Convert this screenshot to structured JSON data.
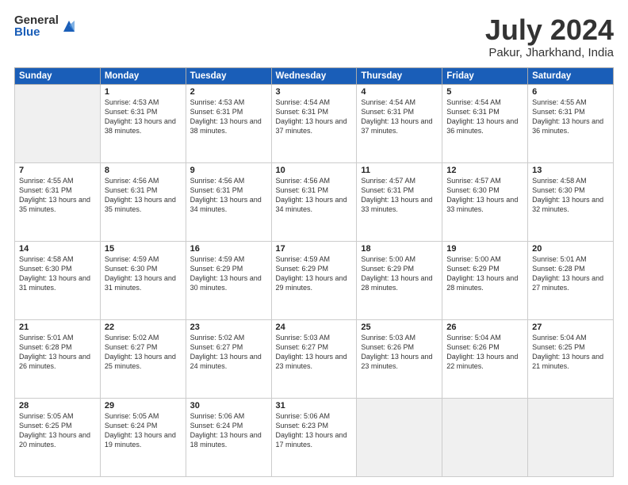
{
  "header": {
    "logo_general": "General",
    "logo_blue": "Blue",
    "main_title": "July 2024",
    "subtitle": "Pakur, Jharkhand, India"
  },
  "calendar": {
    "headers": [
      "Sunday",
      "Monday",
      "Tuesday",
      "Wednesday",
      "Thursday",
      "Friday",
      "Saturday"
    ],
    "weeks": [
      [
        {
          "day": "",
          "info": ""
        },
        {
          "day": "1",
          "info": "Sunrise: 4:53 AM\nSunset: 6:31 PM\nDaylight: 13 hours\nand 38 minutes."
        },
        {
          "day": "2",
          "info": "Sunrise: 4:53 AM\nSunset: 6:31 PM\nDaylight: 13 hours\nand 38 minutes."
        },
        {
          "day": "3",
          "info": "Sunrise: 4:54 AM\nSunset: 6:31 PM\nDaylight: 13 hours\nand 37 minutes."
        },
        {
          "day": "4",
          "info": "Sunrise: 4:54 AM\nSunset: 6:31 PM\nDaylight: 13 hours\nand 37 minutes."
        },
        {
          "day": "5",
          "info": "Sunrise: 4:54 AM\nSunset: 6:31 PM\nDaylight: 13 hours\nand 36 minutes."
        },
        {
          "day": "6",
          "info": "Sunrise: 4:55 AM\nSunset: 6:31 PM\nDaylight: 13 hours\nand 36 minutes."
        }
      ],
      [
        {
          "day": "7",
          "info": "Sunrise: 4:55 AM\nSunset: 6:31 PM\nDaylight: 13 hours\nand 35 minutes."
        },
        {
          "day": "8",
          "info": "Sunrise: 4:56 AM\nSunset: 6:31 PM\nDaylight: 13 hours\nand 35 minutes."
        },
        {
          "day": "9",
          "info": "Sunrise: 4:56 AM\nSunset: 6:31 PM\nDaylight: 13 hours\nand 34 minutes."
        },
        {
          "day": "10",
          "info": "Sunrise: 4:56 AM\nSunset: 6:31 PM\nDaylight: 13 hours\nand 34 minutes."
        },
        {
          "day": "11",
          "info": "Sunrise: 4:57 AM\nSunset: 6:31 PM\nDaylight: 13 hours\nand 33 minutes."
        },
        {
          "day": "12",
          "info": "Sunrise: 4:57 AM\nSunset: 6:30 PM\nDaylight: 13 hours\nand 33 minutes."
        },
        {
          "day": "13",
          "info": "Sunrise: 4:58 AM\nSunset: 6:30 PM\nDaylight: 13 hours\nand 32 minutes."
        }
      ],
      [
        {
          "day": "14",
          "info": "Sunrise: 4:58 AM\nSunset: 6:30 PM\nDaylight: 13 hours\nand 31 minutes."
        },
        {
          "day": "15",
          "info": "Sunrise: 4:59 AM\nSunset: 6:30 PM\nDaylight: 13 hours\nand 31 minutes."
        },
        {
          "day": "16",
          "info": "Sunrise: 4:59 AM\nSunset: 6:29 PM\nDaylight: 13 hours\nand 30 minutes."
        },
        {
          "day": "17",
          "info": "Sunrise: 4:59 AM\nSunset: 6:29 PM\nDaylight: 13 hours\nand 29 minutes."
        },
        {
          "day": "18",
          "info": "Sunrise: 5:00 AM\nSunset: 6:29 PM\nDaylight: 13 hours\nand 28 minutes."
        },
        {
          "day": "19",
          "info": "Sunrise: 5:00 AM\nSunset: 6:29 PM\nDaylight: 13 hours\nand 28 minutes."
        },
        {
          "day": "20",
          "info": "Sunrise: 5:01 AM\nSunset: 6:28 PM\nDaylight: 13 hours\nand 27 minutes."
        }
      ],
      [
        {
          "day": "21",
          "info": "Sunrise: 5:01 AM\nSunset: 6:28 PM\nDaylight: 13 hours\nand 26 minutes."
        },
        {
          "day": "22",
          "info": "Sunrise: 5:02 AM\nSunset: 6:27 PM\nDaylight: 13 hours\nand 25 minutes."
        },
        {
          "day": "23",
          "info": "Sunrise: 5:02 AM\nSunset: 6:27 PM\nDaylight: 13 hours\nand 24 minutes."
        },
        {
          "day": "24",
          "info": "Sunrise: 5:03 AM\nSunset: 6:27 PM\nDaylight: 13 hours\nand 23 minutes."
        },
        {
          "day": "25",
          "info": "Sunrise: 5:03 AM\nSunset: 6:26 PM\nDaylight: 13 hours\nand 23 minutes."
        },
        {
          "day": "26",
          "info": "Sunrise: 5:04 AM\nSunset: 6:26 PM\nDaylight: 13 hours\nand 22 minutes."
        },
        {
          "day": "27",
          "info": "Sunrise: 5:04 AM\nSunset: 6:25 PM\nDaylight: 13 hours\nand 21 minutes."
        }
      ],
      [
        {
          "day": "28",
          "info": "Sunrise: 5:05 AM\nSunset: 6:25 PM\nDaylight: 13 hours\nand 20 minutes."
        },
        {
          "day": "29",
          "info": "Sunrise: 5:05 AM\nSunset: 6:24 PM\nDaylight: 13 hours\nand 19 minutes."
        },
        {
          "day": "30",
          "info": "Sunrise: 5:06 AM\nSunset: 6:24 PM\nDaylight: 13 hours\nand 18 minutes."
        },
        {
          "day": "31",
          "info": "Sunrise: 5:06 AM\nSunset: 6:23 PM\nDaylight: 13 hours\nand 17 minutes."
        },
        {
          "day": "",
          "info": ""
        },
        {
          "day": "",
          "info": ""
        },
        {
          "day": "",
          "info": ""
        }
      ]
    ]
  }
}
